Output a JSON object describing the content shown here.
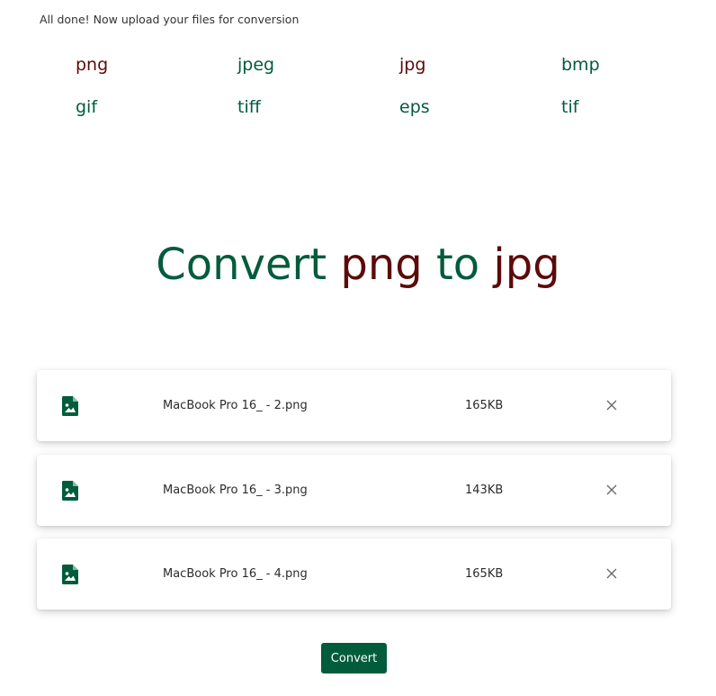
{
  "status_text": "All done! Now upload your files for conversion",
  "colors": {
    "green": "#005c3b",
    "maroon": "#5c0a0a",
    "icon_gray": "#6b6b6b"
  },
  "formats": [
    {
      "label": "png",
      "color": "maroon"
    },
    {
      "label": "jpeg",
      "color": "green"
    },
    {
      "label": "jpg",
      "color": "maroon"
    },
    {
      "label": "bmp",
      "color": "green"
    },
    {
      "label": "gif",
      "color": "green"
    },
    {
      "label": "tiff",
      "color": "green"
    },
    {
      "label": "eps",
      "color": "green"
    },
    {
      "label": "tif",
      "color": "green"
    }
  ],
  "heading": {
    "prefix": "Convert",
    "from": "png",
    "connector": "to",
    "to": "jpg"
  },
  "files": [
    {
      "name": "MacBook Pro 16_ - 2.png",
      "size": "165KB",
      "icon": "image-file-icon"
    },
    {
      "name": "MacBook Pro 16_ - 3.png",
      "size": "143KB",
      "icon": "image-file-icon"
    },
    {
      "name": "MacBook Pro 16_ - 4.png",
      "size": "165KB",
      "icon": "image-file-icon"
    }
  ],
  "convert_label": "Convert"
}
